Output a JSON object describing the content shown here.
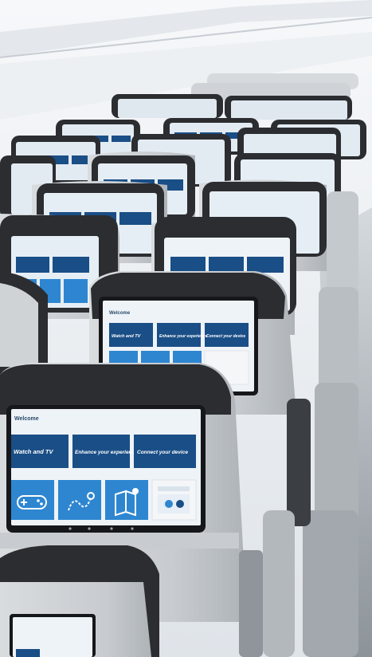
{
  "scene": {
    "subject": "aircraft cabin rows with seatback entertainment screens",
    "colors": {
      "cabin": "#e9edf1",
      "ceiling": "#f3f5f7",
      "seat_shell": "#cfd3d6",
      "seat_headrest": "#2b2d31",
      "screen_bezel": "#15171a",
      "screen_bg": "#eef3f8",
      "tile_dark": "#1a4e86",
      "tile_light": "#2e86d0",
      "tile_white": "#f4f6f8"
    }
  },
  "screen": {
    "welcome": "Welcome",
    "tiles": {
      "watch": "Watch and TV",
      "enhance": "Enhance your experience",
      "connect": "Connect your device"
    },
    "icons": [
      "gamepad-icon",
      "route-map-icon",
      "book-map-icon",
      "family-icon"
    ]
  }
}
